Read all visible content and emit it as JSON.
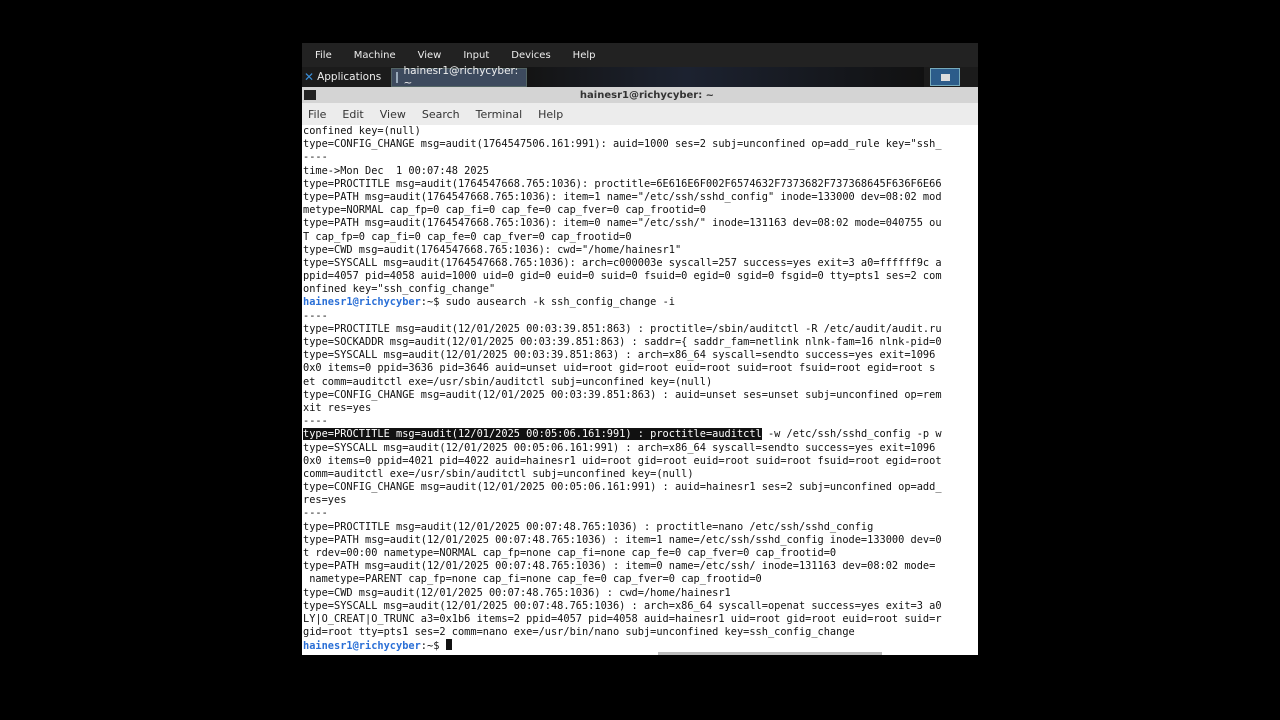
{
  "vbox_menu": [
    "File",
    "Machine",
    "View",
    "Input",
    "Devices",
    "Help"
  ],
  "panel": {
    "applications_label": "Applications",
    "task_label": "hainesr1@richycyber: ~"
  },
  "window": {
    "title": "hainesr1@richycyber: ~"
  },
  "terminal_menu": [
    "File",
    "Edit",
    "View",
    "Search",
    "Terminal",
    "Help"
  ],
  "terminal_lines": [
    {
      "text": "confined key=(null)"
    },
    {
      "text": "type=CONFIG_CHANGE msg=audit(1764547506.161:991): auid=1000 ses=2 subj=unconfined op=add_rule key=\"ssh_"
    },
    {
      "text": "----"
    },
    {
      "text": "time->Mon Dec  1 00:07:48 2025"
    },
    {
      "text": "type=PROCTITLE msg=audit(1764547668.765:1036): proctitle=6E616E6F002F6574632F7373682F737368645F636F6E66"
    },
    {
      "text": "type=PATH msg=audit(1764547668.765:1036): item=1 name=\"/etc/ssh/sshd_config\" inode=133000 dev=08:02 mod"
    },
    {
      "text": "metype=NORMAL cap_fp=0 cap_fi=0 cap_fe=0 cap_fver=0 cap_frootid=0"
    },
    {
      "text": "type=PATH msg=audit(1764547668.765:1036): item=0 name=\"/etc/ssh/\" inode=131163 dev=08:02 mode=040755 ou"
    },
    {
      "text": "T cap_fp=0 cap_fi=0 cap_fe=0 cap_fver=0 cap_frootid=0"
    },
    {
      "text": "type=CWD msg=audit(1764547668.765:1036): cwd=\"/home/hainesr1\""
    },
    {
      "text": "type=SYSCALL msg=audit(1764547668.765:1036): arch=c000003e syscall=257 success=yes exit=3 a0=ffffff9c a"
    },
    {
      "text": "ppid=4057 pid=4058 auid=1000 uid=0 gid=0 euid=0 suid=0 fsuid=0 egid=0 sgid=0 fsgid=0 tty=pts1 ses=2 com"
    },
    {
      "text": "onfined key=\"ssh_config_change\""
    },
    {
      "prompt": "hainesr1@richycyber",
      "text": ":~$ sudo ausearch -k ssh_config_change -i"
    },
    {
      "text": "----"
    },
    {
      "text": "type=PROCTITLE msg=audit(12/01/2025 00:03:39.851:863) : proctitle=/sbin/auditctl -R /etc/audit/audit.ru"
    },
    {
      "text": "type=SOCKADDR msg=audit(12/01/2025 00:03:39.851:863) : saddr={ saddr_fam=netlink nlnk-fam=16 nlnk-pid=0"
    },
    {
      "text": "type=SYSCALL msg=audit(12/01/2025 00:03:39.851:863) : arch=x86_64 syscall=sendto success=yes exit=1096 "
    },
    {
      "text": "0x0 items=0 ppid=3636 pid=3646 auid=unset uid=root gid=root euid=root suid=root fsuid=root egid=root s"
    },
    {
      "text": "et comm=auditctl exe=/usr/sbin/auditctl subj=unconfined key=(null)"
    },
    {
      "text": "type=CONFIG_CHANGE msg=audit(12/01/2025 00:03:39.851:863) : auid=unset ses=unset subj=unconfined op=rem"
    },
    {
      "text": "xit res=yes"
    },
    {
      "text": "----"
    },
    {
      "highlight": "type=PROCTITLE msg=audit(12/01/2025 00:05:06.161:991) : proctitle=auditctl",
      "text": " -w /etc/ssh/sshd_config -p w"
    },
    {
      "text": "type=SYSCALL msg=audit(12/01/2025 00:05:06.161:991) : arch=x86_64 syscall=sendto success=yes exit=1096 "
    },
    {
      "text": "0x0 items=0 ppid=4021 pid=4022 auid=hainesr1 uid=root gid=root euid=root suid=root fsuid=root egid=root"
    },
    {
      "text": "comm=auditctl exe=/usr/sbin/auditctl subj=unconfined key=(null)"
    },
    {
      "text": "type=CONFIG_CHANGE msg=audit(12/01/2025 00:05:06.161:991) : auid=hainesr1 ses=2 subj=unconfined op=add_"
    },
    {
      "text": "res=yes"
    },
    {
      "text": "----"
    },
    {
      "text": "type=PROCTITLE msg=audit(12/01/2025 00:07:48.765:1036) : proctitle=nano /etc/ssh/sshd_config"
    },
    {
      "text": "type=PATH msg=audit(12/01/2025 00:07:48.765:1036) : item=1 name=/etc/ssh/sshd_config inode=133000 dev=0"
    },
    {
      "text": "t rdev=00:00 nametype=NORMAL cap_fp=none cap_fi=none cap_fe=0 cap_fver=0 cap_frootid=0"
    },
    {
      "text": "type=PATH msg=audit(12/01/2025 00:07:48.765:1036) : item=0 name=/etc/ssh/ inode=131163 dev=08:02 mode="
    },
    {
      "text": " nametype=PARENT cap_fp=none cap_fi=none cap_fe=0 cap_fver=0 cap_frootid=0"
    },
    {
      "text": "type=CWD msg=audit(12/01/2025 00:07:48.765:1036) : cwd=/home/hainesr1"
    },
    {
      "text": "type=SYSCALL msg=audit(12/01/2025 00:07:48.765:1036) : arch=x86_64 syscall=openat success=yes exit=3 a0"
    },
    {
      "text": "LY|O_CREAT|O_TRUNC a3=0x1b6 items=2 ppid=4057 pid=4058 auid=hainesr1 uid=root gid=root euid=root suid=r"
    },
    {
      "text": "gid=root tty=pts1 ses=2 comm=nano exe=/usr/bin/nano subj=unconfined key=ssh_config_change"
    },
    {
      "prompt": "hainesr1@richycyber",
      "text": ":~$ ",
      "cursor": true
    }
  ],
  "colors": {
    "prompt": "#2a6fd6",
    "terminal_bg": "#ffffff",
    "highlight_bg": "#111111"
  }
}
